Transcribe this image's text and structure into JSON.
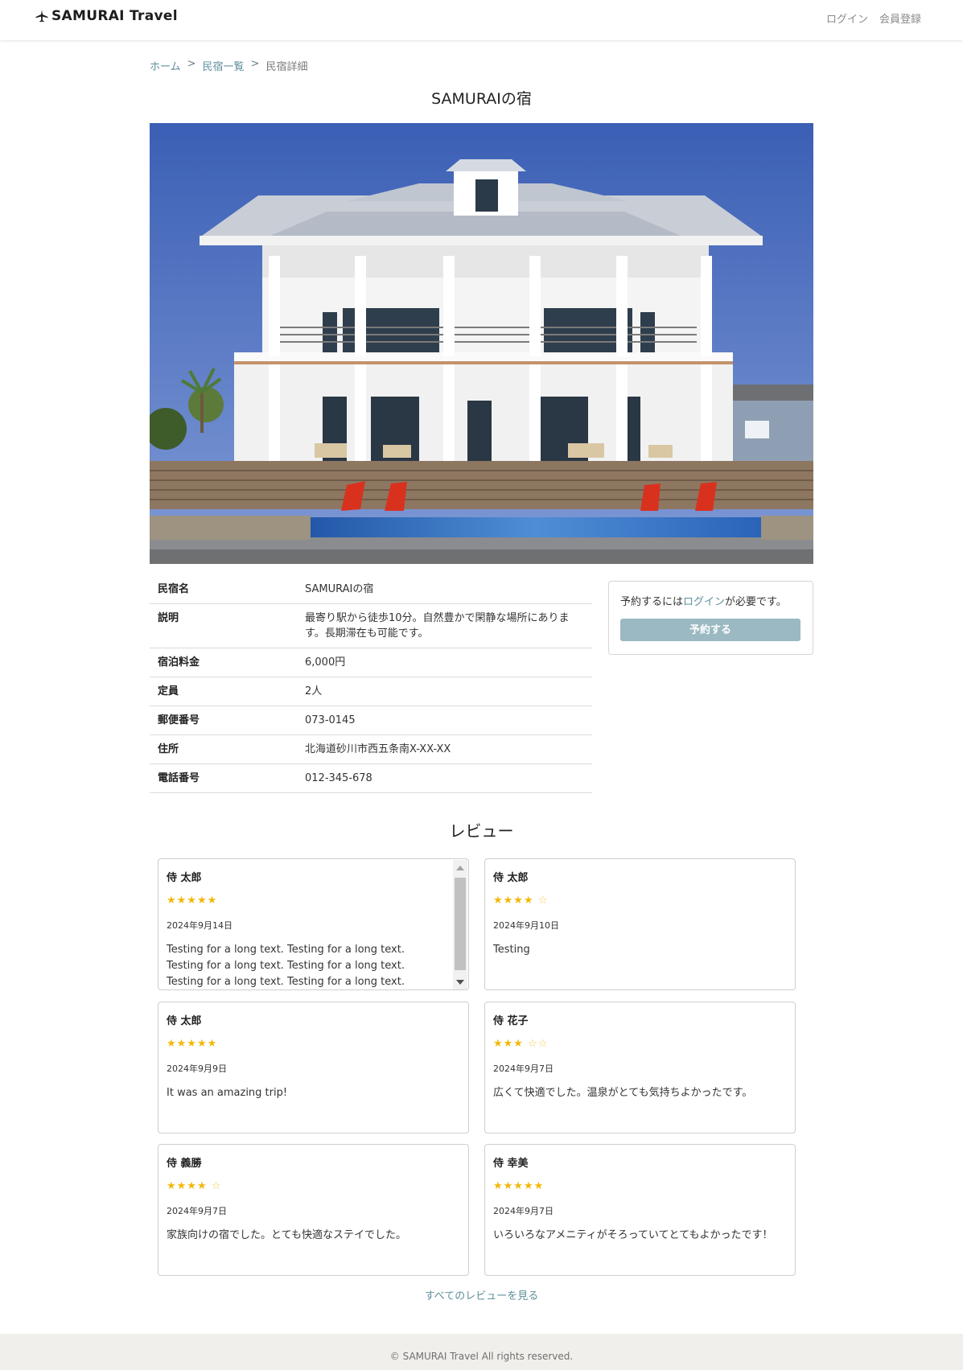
{
  "header": {
    "logo_text": "SAMURAI Travel",
    "login": "ログイン",
    "register": "会員登録"
  },
  "breadcrumb": {
    "home": "ホーム",
    "sep": ">",
    "list": "民宿一覧",
    "current": "民宿詳細"
  },
  "page_title": "SAMURAIの宿",
  "info": [
    {
      "label": "民宿名",
      "value": "SAMURAIの宿"
    },
    {
      "label": "説明",
      "value": "最寄り駅から徒歩10分。自然豊かで閑静な場所にあります。長期滞在も可能です。"
    },
    {
      "label": "宿泊料金",
      "value": "6,000円"
    },
    {
      "label": "定員",
      "value": "2人"
    },
    {
      "label": "郵便番号",
      "value": "073-0145"
    },
    {
      "label": "住所",
      "value": "北海道砂川市西五条南X-XX-XX"
    },
    {
      "label": "電話番号",
      "value": "012-345-678"
    }
  ],
  "booking": {
    "text_before": "予約するには",
    "login_link": "ログイン",
    "text_after": "が必要です。",
    "button": "予約する"
  },
  "reviews_title": "レビュー",
  "reviews": [
    {
      "name": "侍 太郎",
      "stars_on": "★★★★★",
      "stars_off": "",
      "rating": 5,
      "date": "2024年9月14日",
      "text": "Testing for a long text. Testing for a long text. Testing for a long text. Testing for a long text. Testing for a long text. Testing for a long text."
    },
    {
      "name": "侍 太郎",
      "stars_on": "★★★★",
      "stars_off": "☆",
      "rating": 4,
      "date": "2024年9月10日",
      "text": "Testing"
    },
    {
      "name": "侍 太郎",
      "stars_on": "★★★★★",
      "stars_off": "",
      "rating": 5,
      "date": "2024年9月9日",
      "text": "It was an amazing trip!"
    },
    {
      "name": "侍 花子",
      "stars_on": "★★★",
      "stars_off": "☆☆",
      "rating": 3,
      "date": "2024年9月7日",
      "text": "広くて快適でした。温泉がとても気持ちよかったです。"
    },
    {
      "name": "侍 義勝",
      "stars_on": "★★★★",
      "stars_off": "☆",
      "rating": 4,
      "date": "2024年9月7日",
      "text": "家族向けの宿でした。とても快適なステイでした。"
    },
    {
      "name": "侍 幸美",
      "stars_on": "★★★★★",
      "stars_off": "",
      "rating": 5,
      "date": "2024年9月7日",
      "text": "いろいろなアメニティがそろっていてとてもよかったです！"
    }
  ],
  "all_reviews_link": "すべてのレビューを見る",
  "footer": "© SAMURAI Travel All rights reserved.",
  "colors": {
    "accent": "#5f8f9b",
    "button": "#9ab9c2",
    "star": "#f2b809",
    "footer_bg": "#f0efeb"
  }
}
